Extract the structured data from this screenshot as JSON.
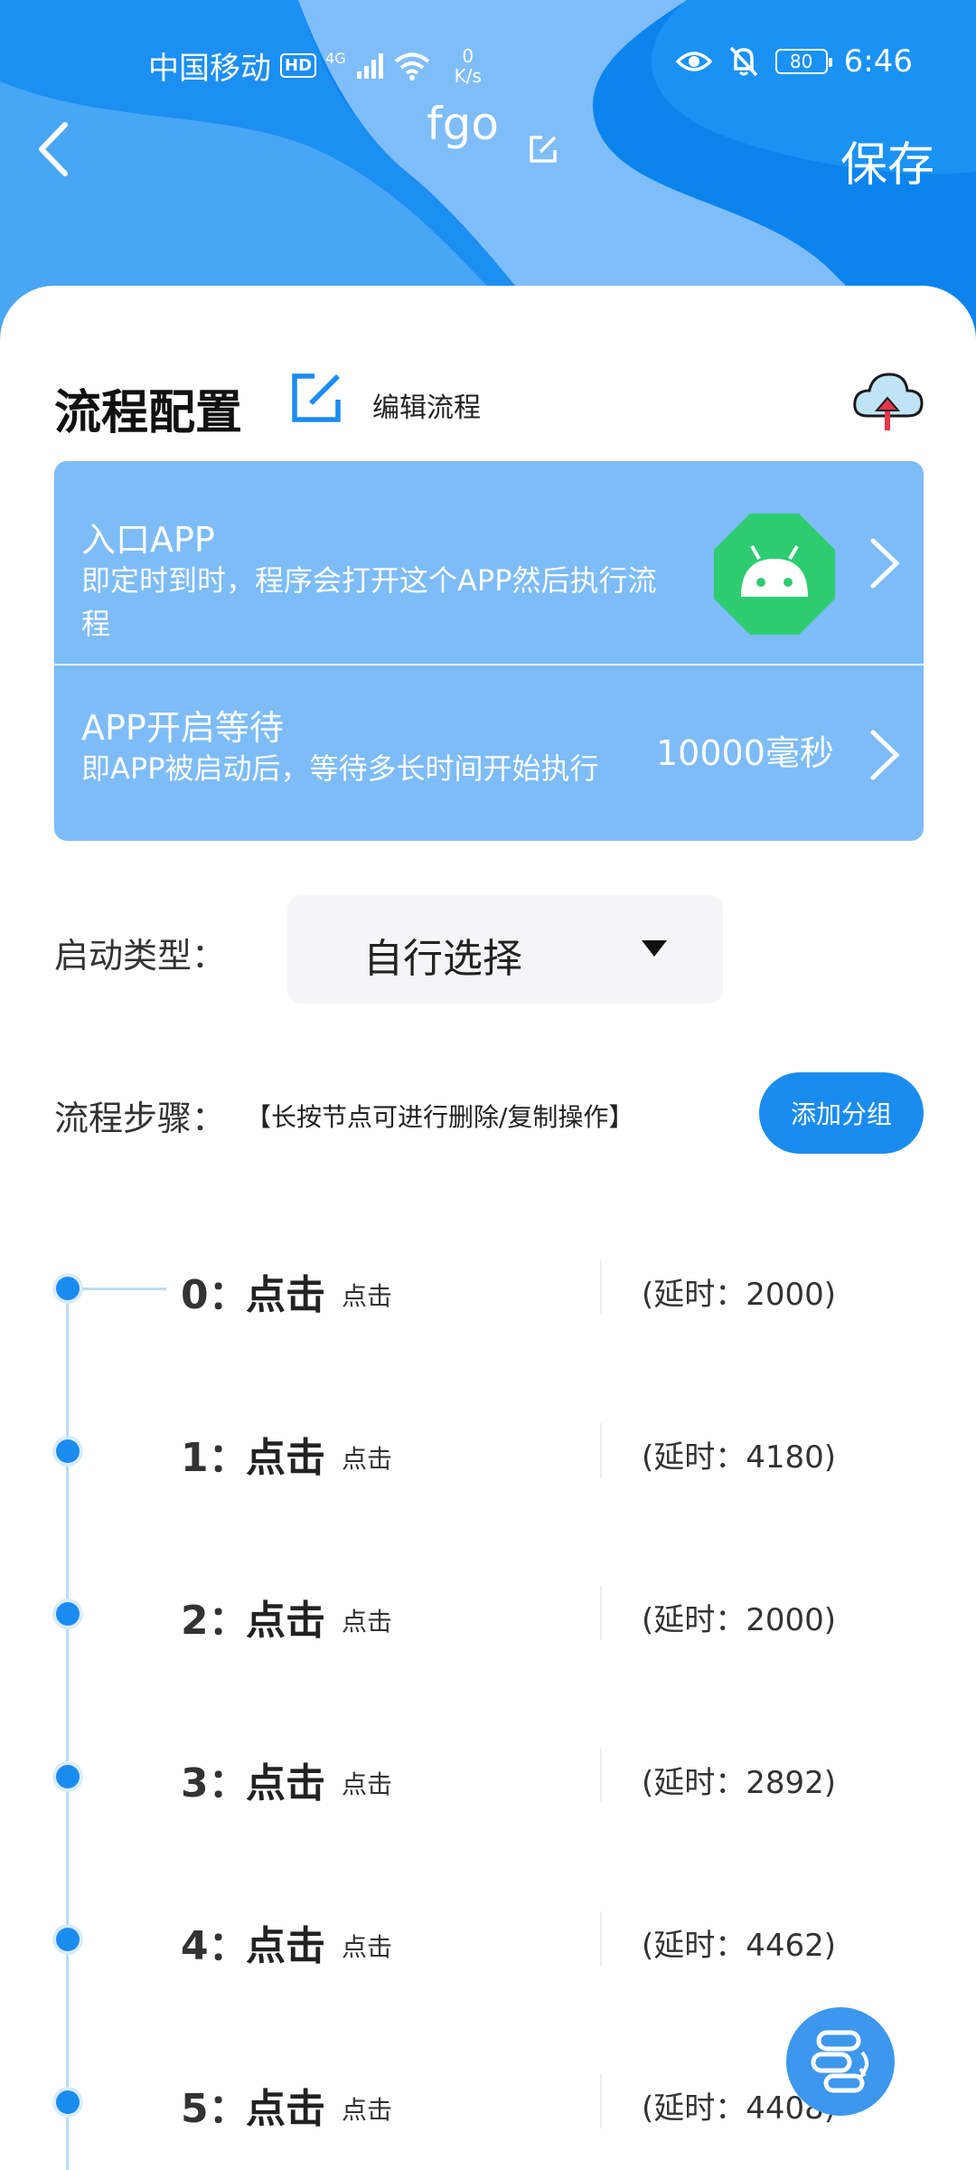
{
  "status_bar": {
    "carrier": "中国移动",
    "hd": "HD",
    "signal_type": "4G",
    "net_speed_value": "0",
    "net_speed_unit": "K/s",
    "battery": "80",
    "time": "6:46"
  },
  "header": {
    "title": "fgo",
    "save_label": "保存"
  },
  "section": {
    "title": "流程配置",
    "edit_label": "编辑流程"
  },
  "entry_app": {
    "title": "入口APP",
    "description": "即定时到时，程序会打开这个APP然后执行流程"
  },
  "app_wait": {
    "title": "APP开启等待",
    "description": "即APP被启动后，等待多长时间开始执行",
    "value": "10000毫秒"
  },
  "launch_type": {
    "label": "启动类型：",
    "value": "自行选择"
  },
  "steps": {
    "label": "流程步骤：",
    "hint": "【长按节点可进行删除/复制操作】",
    "add_group_label": "添加分组",
    "items": [
      {
        "index": "0：",
        "action": "点击",
        "sub": "点击",
        "delay": "(延时：2000)"
      },
      {
        "index": "1：",
        "action": "点击",
        "sub": "点击",
        "delay": "(延时：4180)"
      },
      {
        "index": "2：",
        "action": "点击",
        "sub": "点击",
        "delay": "(延时：2000)"
      },
      {
        "index": "3：",
        "action": "点击",
        "sub": "点击",
        "delay": "(延时：2892)"
      },
      {
        "index": "4：",
        "action": "点击",
        "sub": "点击",
        "delay": "(延时：4462)"
      },
      {
        "index": "5：",
        "action": "点击",
        "sub": "点击",
        "delay": "(延时：4408)"
      }
    ]
  },
  "colors": {
    "primary": "#1a8cf0",
    "panel": "#7dbcf7",
    "android_green": "#2ecc71"
  }
}
